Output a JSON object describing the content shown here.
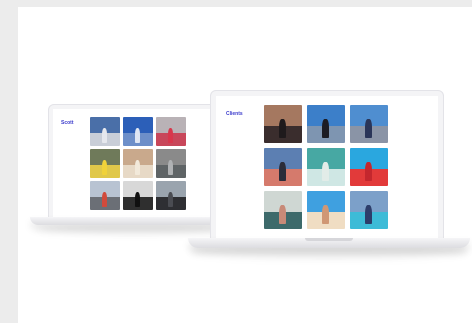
{
  "back_laptop": {
    "title": "Scott",
    "thumbs": [
      {
        "name": "airplane-photo",
        "sky": "#4a6fa8",
        "ground": "#c9ced8",
        "fig": "#e6e8ee"
      },
      {
        "name": "jet-sky-photo",
        "sky": "#2c5fb8",
        "ground": "#6d8fc9",
        "fig": "#dfe6f3"
      },
      {
        "name": "crew-group-photo",
        "sky": "#b9b2b6",
        "ground": "#c8475a",
        "fig": "#d8374c"
      },
      {
        "name": "yellow-vest-photo",
        "sky": "#6f7a5a",
        "ground": "#e0c84a",
        "fig": "#f0d23a"
      },
      {
        "name": "balloon-photo",
        "sky": "#c9a98c",
        "ground": "#e7d9c6",
        "fig": "#f2e9da"
      },
      {
        "name": "aircraft-interior-photo",
        "sky": "#8a8a8a",
        "ground": "#5f6466",
        "fig": "#b0b2b4"
      },
      {
        "name": "runway-photo",
        "sky": "#b8c3d2",
        "ground": "#6b6f76",
        "fig": "#d14a3c"
      },
      {
        "name": "sign-letters-photo",
        "sky": "#d8d8d8",
        "ground": "#2f2f2f",
        "fig": "#101010"
      },
      {
        "name": "crowd-photo",
        "sky": "#9aa4ae",
        "ground": "#2e2f33",
        "fig": "#4a4c52"
      }
    ]
  },
  "front_laptop": {
    "title": "Clients",
    "thumbs": [
      {
        "name": "couple-photo",
        "sky": "#a57860",
        "ground": "#3a2d2d",
        "fig": "#1f1a1c"
      },
      {
        "name": "airport-walk-photo",
        "sky": "#3c7fc9",
        "ground": "#7e95b1",
        "fig": "#1c1c24"
      },
      {
        "name": "crew-tarmac-photo",
        "sky": "#4f8ed0",
        "ground": "#8a94a6",
        "fig": "#2a3558"
      },
      {
        "name": "sunset-pier-photo",
        "sky": "#5c7fb2",
        "ground": "#d57a6c",
        "fig": "#2b2d3a"
      },
      {
        "name": "jewelry-table-photo",
        "sky": "#47a8a3",
        "ground": "#cfe7e4",
        "fig": "#e2ece8"
      },
      {
        "name": "red-outfit-photo",
        "sky": "#2aa7df",
        "ground": "#e23a3a",
        "fig": "#c4272e"
      },
      {
        "name": "office-desk-photo",
        "sky": "#cfd7d3",
        "ground": "#3d6a6b",
        "fig": "#c88a78"
      },
      {
        "name": "beach-selfie-photo",
        "sky": "#3fa0e0",
        "ground": "#f0ddc3",
        "fig": "#d09774"
      },
      {
        "name": "runway-plane-photo",
        "sky": "#7ca0c9",
        "ground": "#3dbbd7",
        "fig": "#2d3d6a"
      }
    ]
  }
}
